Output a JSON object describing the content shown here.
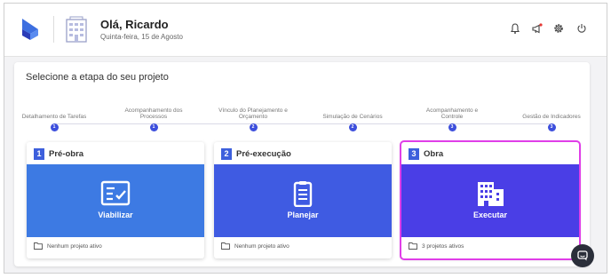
{
  "header": {
    "greeting": "Olá, Ricardo",
    "date": "Quinta-feira, 15 de Agosto",
    "icons": [
      "bell-icon",
      "megaphone-icon",
      "gear-icon",
      "power-icon"
    ]
  },
  "panel": {
    "title": "Selecione a etapa do seu projeto"
  },
  "steps": [
    {
      "label": "Detalhamento de Tarefas",
      "phase": "1"
    },
    {
      "label": "Acompanhamento dos Processos",
      "phase": "1"
    },
    {
      "label": "Vínculo do Planejamento e Orçamento",
      "phase": "2"
    },
    {
      "label": "Simulação de Cenários",
      "phase": "2"
    },
    {
      "label": "Acompanhamento e Controle",
      "phase": "3"
    },
    {
      "label": "Gestão de Indicadores",
      "phase": "3"
    }
  ],
  "cards": [
    {
      "number": "1",
      "name": "Pré-obra",
      "action": "Viabilizar",
      "status": "Nenhum projeto ativo",
      "color": "#3d7ae3",
      "icon": "checklist-icon"
    },
    {
      "number": "2",
      "name": "Pré-execução",
      "action": "Planejar",
      "status": "Nenhum projeto ativo",
      "color": "#3f5be2",
      "icon": "clipboard-icon"
    },
    {
      "number": "3",
      "name": "Obra",
      "action": "Executar",
      "status": "3 projetos ativos",
      "color": "#4a3ee6",
      "icon": "building-icon"
    }
  ],
  "colors": {
    "accent": "#3d4fdc",
    "selection_outline": "#e03ee8",
    "notification_dot": "#e53935"
  }
}
